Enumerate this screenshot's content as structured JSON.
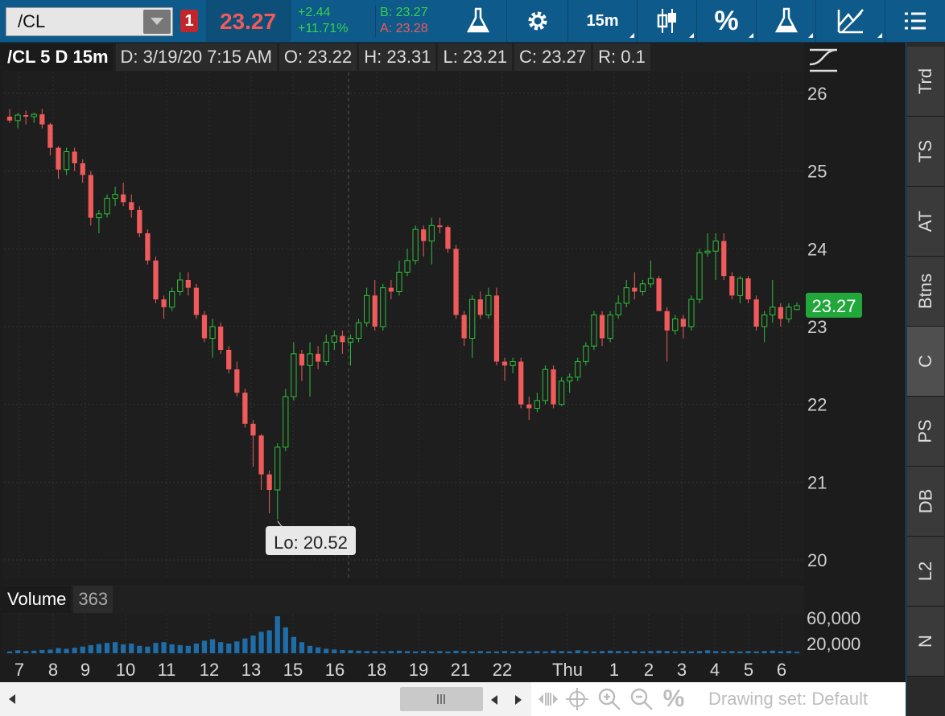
{
  "toolbar": {
    "symbol": "/CL",
    "link_badge": "1",
    "last_price": "23.27",
    "net_change": "+2.44",
    "pct_change": "+11.71%",
    "bid": "B: 23.27",
    "ask": "A: 23.28",
    "timeframe": "15m",
    "percent_label": "%"
  },
  "info": {
    "title": "/CL 5 D 15m",
    "date": "D: 3/19/20 7:15 AM",
    "open": "O: 23.22",
    "high": "H: 23.31",
    "low": "L: 23.21",
    "close": "C: 23.27",
    "range": "R: 0.1"
  },
  "volume": {
    "label": "Volume",
    "value": "363"
  },
  "right_tabs": [
    "Trd",
    "TS",
    "AT",
    "Btns",
    "C",
    "PS",
    "DB",
    "L2",
    "N"
  ],
  "active_tab": "C",
  "bottom": {
    "drawing_set": "Drawing set: Default"
  },
  "colors": {
    "up": "#2fbf3a",
    "down": "#f05a5a",
    "price_tag": "#21a73a",
    "toolbar": "#0e5a8a"
  },
  "chart_data": {
    "type": "candlestick",
    "ylim": [
      20,
      26
    ],
    "y_ticks": [
      "26",
      "25",
      "24",
      "23",
      "22",
      "21",
      "20"
    ],
    "x_ticks": [
      "7",
      "8",
      "9",
      "10",
      "11",
      "12",
      "13",
      "15",
      "16",
      "18",
      "19",
      "21",
      "22",
      "Thu",
      "1",
      "2",
      "3",
      "4",
      "5",
      "6"
    ],
    "last_price_tag": "23.27",
    "low_annotation": "Lo: 20.52",
    "volume_ticks": [
      "60,000",
      "20,000"
    ],
    "candles": [
      [
        25.7,
        25.8,
        25.62,
        25.65
      ],
      [
        25.65,
        25.75,
        25.55,
        25.72
      ],
      [
        25.72,
        25.78,
        25.6,
        25.7
      ],
      [
        25.7,
        25.75,
        25.62,
        25.73
      ],
      [
        25.73,
        25.8,
        25.55,
        25.6
      ],
      [
        25.6,
        25.62,
        25.2,
        25.3
      ],
      [
        25.3,
        25.32,
        24.9,
        25.02
      ],
      [
        25.02,
        25.3,
        24.95,
        25.25
      ],
      [
        25.25,
        25.3,
        25.0,
        25.1
      ],
      [
        25.1,
        25.15,
        24.85,
        24.95
      ],
      [
        24.95,
        25.0,
        24.3,
        24.4
      ],
      [
        24.4,
        24.5,
        24.2,
        24.45
      ],
      [
        24.45,
        24.7,
        24.4,
        24.65
      ],
      [
        24.65,
        24.8,
        24.55,
        24.7
      ],
      [
        24.7,
        24.85,
        24.55,
        24.6
      ],
      [
        24.6,
        24.7,
        24.4,
        24.5
      ],
      [
        24.5,
        24.55,
        24.15,
        24.2
      ],
      [
        24.2,
        24.25,
        23.8,
        23.85
      ],
      [
        23.85,
        23.9,
        23.3,
        23.35
      ],
      [
        23.35,
        23.4,
        23.1,
        23.25
      ],
      [
        23.25,
        23.5,
        23.2,
        23.45
      ],
      [
        23.45,
        23.7,
        23.4,
        23.6
      ],
      [
        23.6,
        23.7,
        23.4,
        23.5
      ],
      [
        23.5,
        23.55,
        23.1,
        23.15
      ],
      [
        23.15,
        23.2,
        22.8,
        22.85
      ],
      [
        22.85,
        23.1,
        22.6,
        23.0
      ],
      [
        23.0,
        23.05,
        22.65,
        22.7
      ],
      [
        22.7,
        22.75,
        22.4,
        22.45
      ],
      [
        22.45,
        22.55,
        22.1,
        22.15
      ],
      [
        22.15,
        22.2,
        21.7,
        21.75
      ],
      [
        21.75,
        21.8,
        21.2,
        21.6
      ],
      [
        21.6,
        21.62,
        20.9,
        21.1
      ],
      [
        21.1,
        21.15,
        20.6,
        20.9
      ],
      [
        20.9,
        21.5,
        20.52,
        21.45
      ],
      [
        21.45,
        22.2,
        21.4,
        22.1
      ],
      [
        22.1,
        22.8,
        22.05,
        22.65
      ],
      [
        22.65,
        22.7,
        22.3,
        22.5
      ],
      [
        22.5,
        22.8,
        22.1,
        22.65
      ],
      [
        22.65,
        22.75,
        22.45,
        22.55
      ],
      [
        22.55,
        22.9,
        22.5,
        22.8
      ],
      [
        22.8,
        22.95,
        22.7,
        22.88
      ],
      [
        22.88,
        22.95,
        22.65,
        22.8
      ],
      [
        22.8,
        22.9,
        22.5,
        22.85
      ],
      [
        22.85,
        23.1,
        22.8,
        23.05
      ],
      [
        23.05,
        23.5,
        23.0,
        23.4
      ],
      [
        23.4,
        23.6,
        22.95,
        23.0
      ],
      [
        23.0,
        23.55,
        22.95,
        23.5
      ],
      [
        23.5,
        23.6,
        23.35,
        23.45
      ],
      [
        23.45,
        23.85,
        23.4,
        23.7
      ],
      [
        23.7,
        24.0,
        23.65,
        23.85
      ],
      [
        23.85,
        24.3,
        23.8,
        24.25
      ],
      [
        24.25,
        24.3,
        23.9,
        24.1
      ],
      [
        24.1,
        24.4,
        23.8,
        24.3
      ],
      [
        24.3,
        24.4,
        24.2,
        24.28
      ],
      [
        24.28,
        24.3,
        23.95,
        24.0
      ],
      [
        24.0,
        24.05,
        23.1,
        23.15
      ],
      [
        23.15,
        23.2,
        22.75,
        22.85
      ],
      [
        22.85,
        23.4,
        22.6,
        23.35
      ],
      [
        23.35,
        23.45,
        23.1,
        23.15
      ],
      [
        23.15,
        23.5,
        23.1,
        23.4
      ],
      [
        23.4,
        23.5,
        22.5,
        22.55
      ],
      [
        22.55,
        22.6,
        22.3,
        22.5
      ],
      [
        22.5,
        22.6,
        22.4,
        22.55
      ],
      [
        22.55,
        22.6,
        21.95,
        22.0
      ],
      [
        22.0,
        22.1,
        21.8,
        21.95
      ],
      [
        21.95,
        22.15,
        21.9,
        22.05
      ],
      [
        22.05,
        22.5,
        22.0,
        22.45
      ],
      [
        22.45,
        22.5,
        21.95,
        22.0
      ],
      [
        22.0,
        22.35,
        21.98,
        22.3
      ],
      [
        22.3,
        22.4,
        22.15,
        22.35
      ],
      [
        22.35,
        22.6,
        22.3,
        22.55
      ],
      [
        22.55,
        22.8,
        22.5,
        22.75
      ],
      [
        22.75,
        23.2,
        22.7,
        23.15
      ],
      [
        23.15,
        23.2,
        22.75,
        22.85
      ],
      [
        22.85,
        23.2,
        22.8,
        23.15
      ],
      [
        23.15,
        23.4,
        23.1,
        23.3
      ],
      [
        23.3,
        23.6,
        23.25,
        23.5
      ],
      [
        23.5,
        23.7,
        23.35,
        23.45
      ],
      [
        23.45,
        23.6,
        23.4,
        23.55
      ],
      [
        23.55,
        23.85,
        23.5,
        23.62
      ],
      [
        23.62,
        23.65,
        23.2,
        23.2
      ],
      [
        23.2,
        23.25,
        22.55,
        22.95
      ],
      [
        22.95,
        23.15,
        22.9,
        23.1
      ],
      [
        23.1,
        23.15,
        22.85,
        23.0
      ],
      [
        23.0,
        23.4,
        22.95,
        23.35
      ],
      [
        23.35,
        24.0,
        23.3,
        23.95
      ],
      [
        23.95,
        24.2,
        23.9,
        23.97
      ],
      [
        23.97,
        24.2,
        23.6,
        24.1
      ],
      [
        24.1,
        24.2,
        23.6,
        23.65
      ],
      [
        23.65,
        23.7,
        23.35,
        23.4
      ],
      [
        23.4,
        23.65,
        23.3,
        23.62
      ],
      [
        23.62,
        23.65,
        23.3,
        23.35
      ],
      [
        23.35,
        23.4,
        22.95,
        23.0
      ],
      [
        23.0,
        23.2,
        22.8,
        23.15
      ],
      [
        23.15,
        23.6,
        23.05,
        23.25
      ],
      [
        23.25,
        23.3,
        23.0,
        23.1
      ],
      [
        23.1,
        23.3,
        23.05,
        23.25
      ],
      [
        23.22,
        23.31,
        23.21,
        23.27
      ]
    ],
    "volumes": [
      5,
      8,
      6,
      7,
      9,
      10,
      14,
      12,
      15,
      18,
      22,
      25,
      28,
      30,
      24,
      26,
      20,
      18,
      28,
      30,
      24,
      22,
      20,
      26,
      34,
      38,
      30,
      26,
      32,
      40,
      48,
      58,
      62,
      100,
      70,
      44,
      30,
      20,
      16,
      12,
      10,
      9,
      8,
      7,
      6,
      6,
      5,
      6,
      7,
      6,
      5,
      6,
      5,
      6,
      5,
      7,
      6,
      5,
      6,
      5,
      5,
      6,
      5,
      6,
      5,
      6,
      5,
      7,
      6,
      5,
      8,
      6,
      5,
      6,
      7,
      6,
      5,
      6,
      5,
      6,
      7,
      6,
      5,
      6,
      5,
      6,
      8,
      6,
      5,
      6,
      5,
      6,
      5,
      6,
      7,
      5,
      6,
      4
    ]
  }
}
